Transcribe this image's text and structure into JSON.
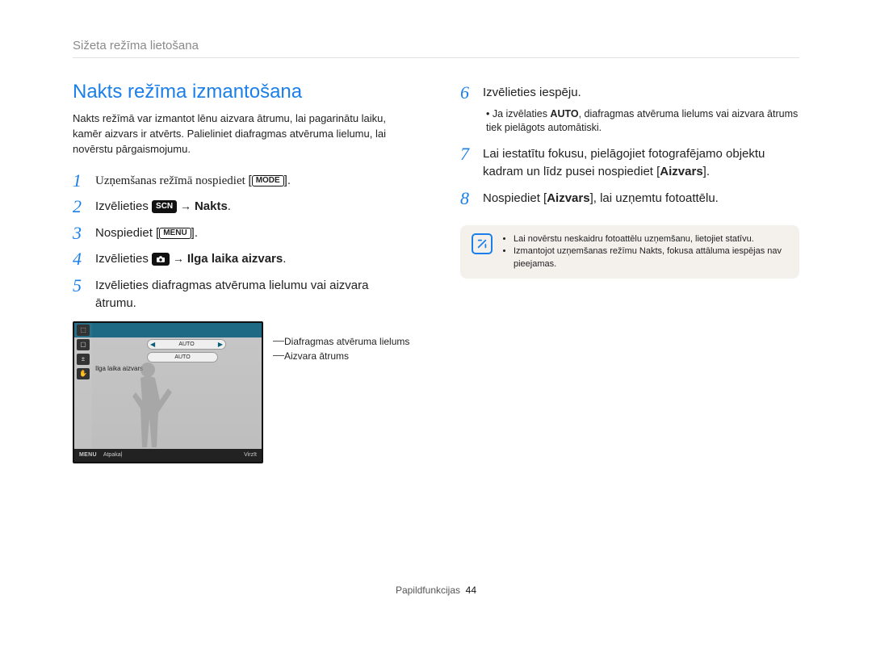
{
  "breadcrumb": "Sižeta režīma lietošana",
  "title": "Nakts režīma izmantošana",
  "intro": "Nakts režīmā var izmantot lēnu aizvara ātrumu, lai pagarinātu laiku, kamēr aizvars ir atvērts. Palieliniet diafragmas atvēruma lielumu, lai novērstu pārgaismojumu.",
  "icons": {
    "mode_label": "MODE",
    "menu_label": "MENU",
    "scn_label": "SCN"
  },
  "steps_left": {
    "s1": {
      "num": "1",
      "text_a": "Uzņemšanas režīmā nospiediet ",
      "text_b": "."
    },
    "s2": {
      "num": "2",
      "text_a": "Izvēlieties ",
      "arrow": " → ",
      "target": "Nakts",
      "text_b": "."
    },
    "s3": {
      "num": "3",
      "text_a": "Nospiediet ",
      "text_b": "."
    },
    "s4": {
      "num": "4",
      "text_a": "Izvēlieties ",
      "arrow": " → ",
      "target": "Ilga laika aizvars",
      "text_b": "."
    },
    "s5": {
      "num": "5",
      "text": "Izvēlieties diafragmas atvēruma lielumu vai aizvara ātrumu."
    }
  },
  "lcd": {
    "lt": "LT",
    "pill1": "AUTO",
    "pill2": "AUTO",
    "ilga": "Ilga laika aizvars",
    "menu": "MENU",
    "back": "Atpakaļ",
    "move": "Virzīt",
    "callout1": "Diafragmas atvēruma lielums",
    "callout2": "Aizvara ātrums"
  },
  "steps_right": {
    "s6": {
      "num": "6",
      "head": "Izvēlieties iespēju.",
      "bullet_a": "Ja izvēlaties ",
      "auto": "AUTO",
      "bullet_b": ", diafragmas atvēruma lielums vai aizvara ātrums tiek pielāgots automātiski."
    },
    "s7": {
      "num": "7",
      "text_a": "Lai iestatītu fokusu, pielāgojiet fotografējamo objektu kadram un līdz pusei nospiediet [",
      "btn": "Aizvars",
      "text_b": "]."
    },
    "s8": {
      "num": "8",
      "text_a": "Nospiediet [",
      "btn": "Aizvars",
      "text_b": "], lai uzņemtu fotoattēlu."
    }
  },
  "note": {
    "n1": "Lai novērstu neskaidru fotoattēlu uzņemšanu, lietojiet statīvu.",
    "n2": "Izmantojot uzņemšanas režīmu Nakts, fokusa attāluma iespējas nav pieejamas."
  },
  "footer": {
    "section": "Papildfunkcijas",
    "page": "44"
  }
}
